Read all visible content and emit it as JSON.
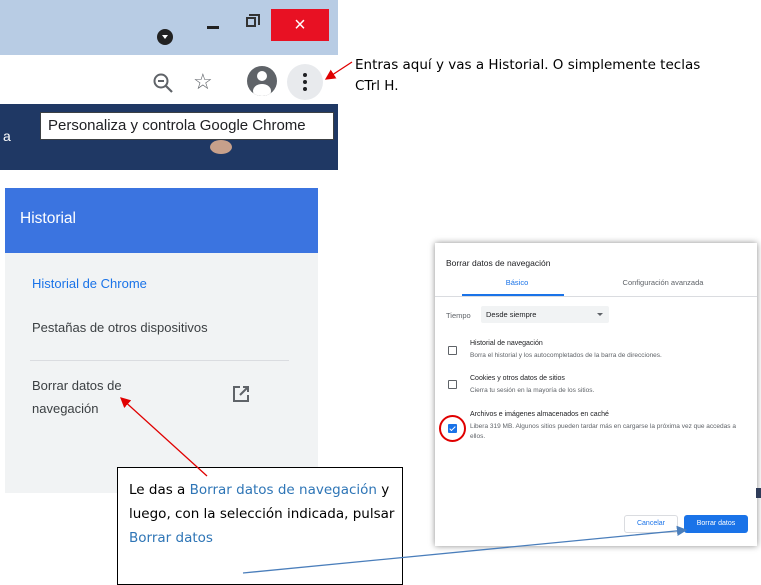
{
  "chrome": {
    "window_controls": {
      "minimize": "minimize-icon",
      "maximize": "maximize-icon",
      "close": "×"
    },
    "toolbar_icons": [
      "zoom-out-icon",
      "star-icon",
      "account-icon",
      "more-vert-icon"
    ],
    "tooltip": "Personaliza y controla Google Chrome",
    "page_fragment": "a"
  },
  "callout_top": {
    "line1": "Entras aquí y vas a Historial.  O simplemente  teclas",
    "line2": "CTrl H."
  },
  "history": {
    "header": "Historial",
    "items": [
      {
        "label": "Historial de Chrome"
      },
      {
        "label": "Pestañas de otros dispositivos"
      },
      {
        "label_line1": "Borrar datos de",
        "label_line2": "navegación",
        "icon": "open-in-new-icon"
      }
    ]
  },
  "dialog": {
    "title": "Borrar datos de navegación",
    "tabs": [
      "Básico",
      "Configuración avanzada"
    ],
    "time_label": "Tiempo",
    "time_value": "Desde siempre",
    "options": [
      {
        "title": "Historial de navegación",
        "desc": "Borra el historial y los autocompletados de la barra de direcciones.",
        "checked": false
      },
      {
        "title": "Cookies y otros datos de sitios",
        "desc": "Cierra tu sesión en la mayoría de los sitios.",
        "checked": false
      },
      {
        "title": "Archivos e imágenes almacenados en caché",
        "desc": "Libera 319 MB. Algunos sitios pueden tardar más en cargarse la próxima vez que accedas a ellos.",
        "checked": true
      }
    ],
    "cancel": "Cancelar",
    "confirm": "Borrar datos"
  },
  "callout_bottom": {
    "t1": "Le das a ",
    "h1": "Borrar datos de navegación",
    "t2": " y luego, con la selección indicada, pulsar ",
    "h2": "Borrar datos"
  },
  "colors": {
    "chrome_blue": "#1a73e8",
    "history_header": "#3b74e0",
    "arrow_red": "#e00000",
    "arrow_blue": "#4a7ebb"
  }
}
